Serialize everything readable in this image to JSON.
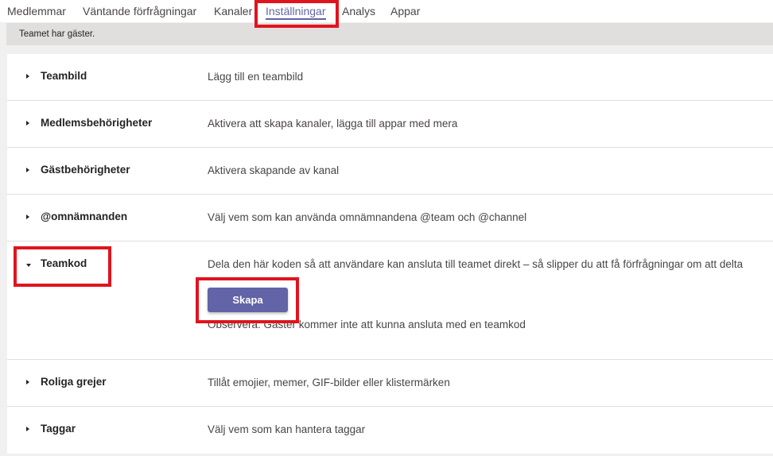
{
  "tabs": [
    {
      "label": "Medlemmar"
    },
    {
      "label": "Väntande förfrågningar"
    },
    {
      "label": "Kanaler"
    },
    {
      "label": "Inställningar"
    },
    {
      "label": "Analys"
    },
    {
      "label": "Appar"
    }
  ],
  "active_tab": "Inställningar",
  "banner": {
    "text": "Teamet har gäster."
  },
  "settings": [
    {
      "title": "Teambild",
      "description": "Lägg till en teambild"
    },
    {
      "title": "Medlemsbehörigheter",
      "description": "Aktivera att skapa kanaler, lägga till appar med mera"
    },
    {
      "title": "Gästbehörigheter",
      "description": "Aktivera skapande av kanal"
    },
    {
      "title": "@omnämnanden",
      "description": "Välj vem som kan använda omnämnandena @team och @channel"
    },
    {
      "title": "Teamkod",
      "description": "Dela den här koden så att användare kan ansluta till teamet direkt – så slipper du att få förfrågningar om att delta",
      "button": "Skapa",
      "note": "Observera: Gäster kommer inte att kunna ansluta med en teamkod"
    },
    {
      "title": "Roliga grejer",
      "description": "Tillåt emojier, memer, GIF-bilder eller klistermärken"
    },
    {
      "title": "Taggar",
      "description": "Välj vem som kan hantera taggar"
    }
  ],
  "colors": {
    "accent": "#6264a7",
    "annotation": "#e0141e"
  }
}
